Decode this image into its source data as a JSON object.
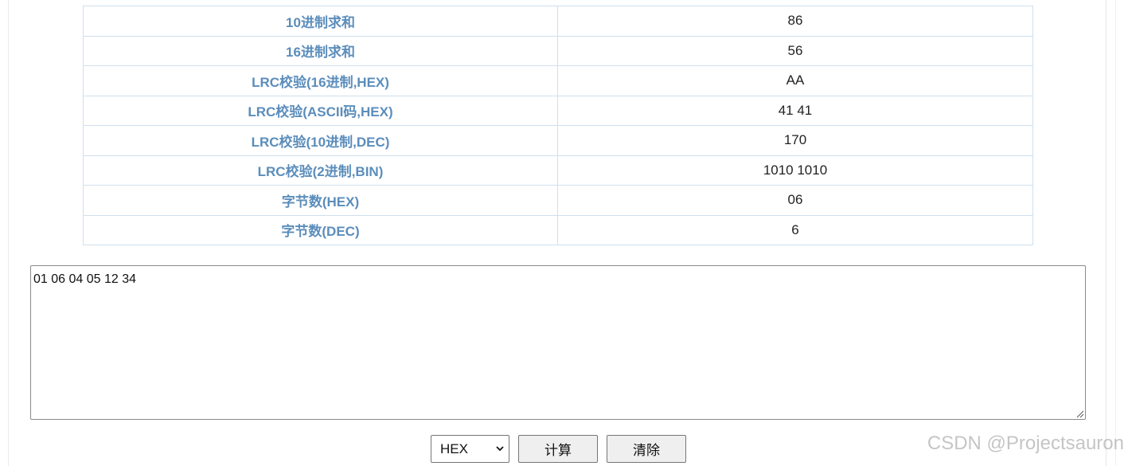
{
  "results": [
    {
      "label": "10进制求和",
      "value": "86"
    },
    {
      "label": "16进制求和",
      "value": "56"
    },
    {
      "label": "LRC校验(16进制,HEX)",
      "value": "AA"
    },
    {
      "label": "LRC校验(ASCII码,HEX)",
      "value": "41 41"
    },
    {
      "label": "LRC校验(10进制,DEC)",
      "value": "170"
    },
    {
      "label": "LRC校验(2进制,BIN)",
      "value": "1010 1010"
    },
    {
      "label": "字节数(HEX)",
      "value": "06"
    },
    {
      "label": "字节数(DEC)",
      "value": "6"
    }
  ],
  "input": {
    "value": "01 06 04 05 12 34"
  },
  "controls": {
    "format_selected": "HEX",
    "calculate_label": "计算",
    "clear_label": "清除"
  },
  "watermark": "CSDN @Projectsauron",
  "colors": {
    "label_text": "#5b8dbb",
    "table_border": "#cfe0ee",
    "button_bg": "#efefef"
  }
}
